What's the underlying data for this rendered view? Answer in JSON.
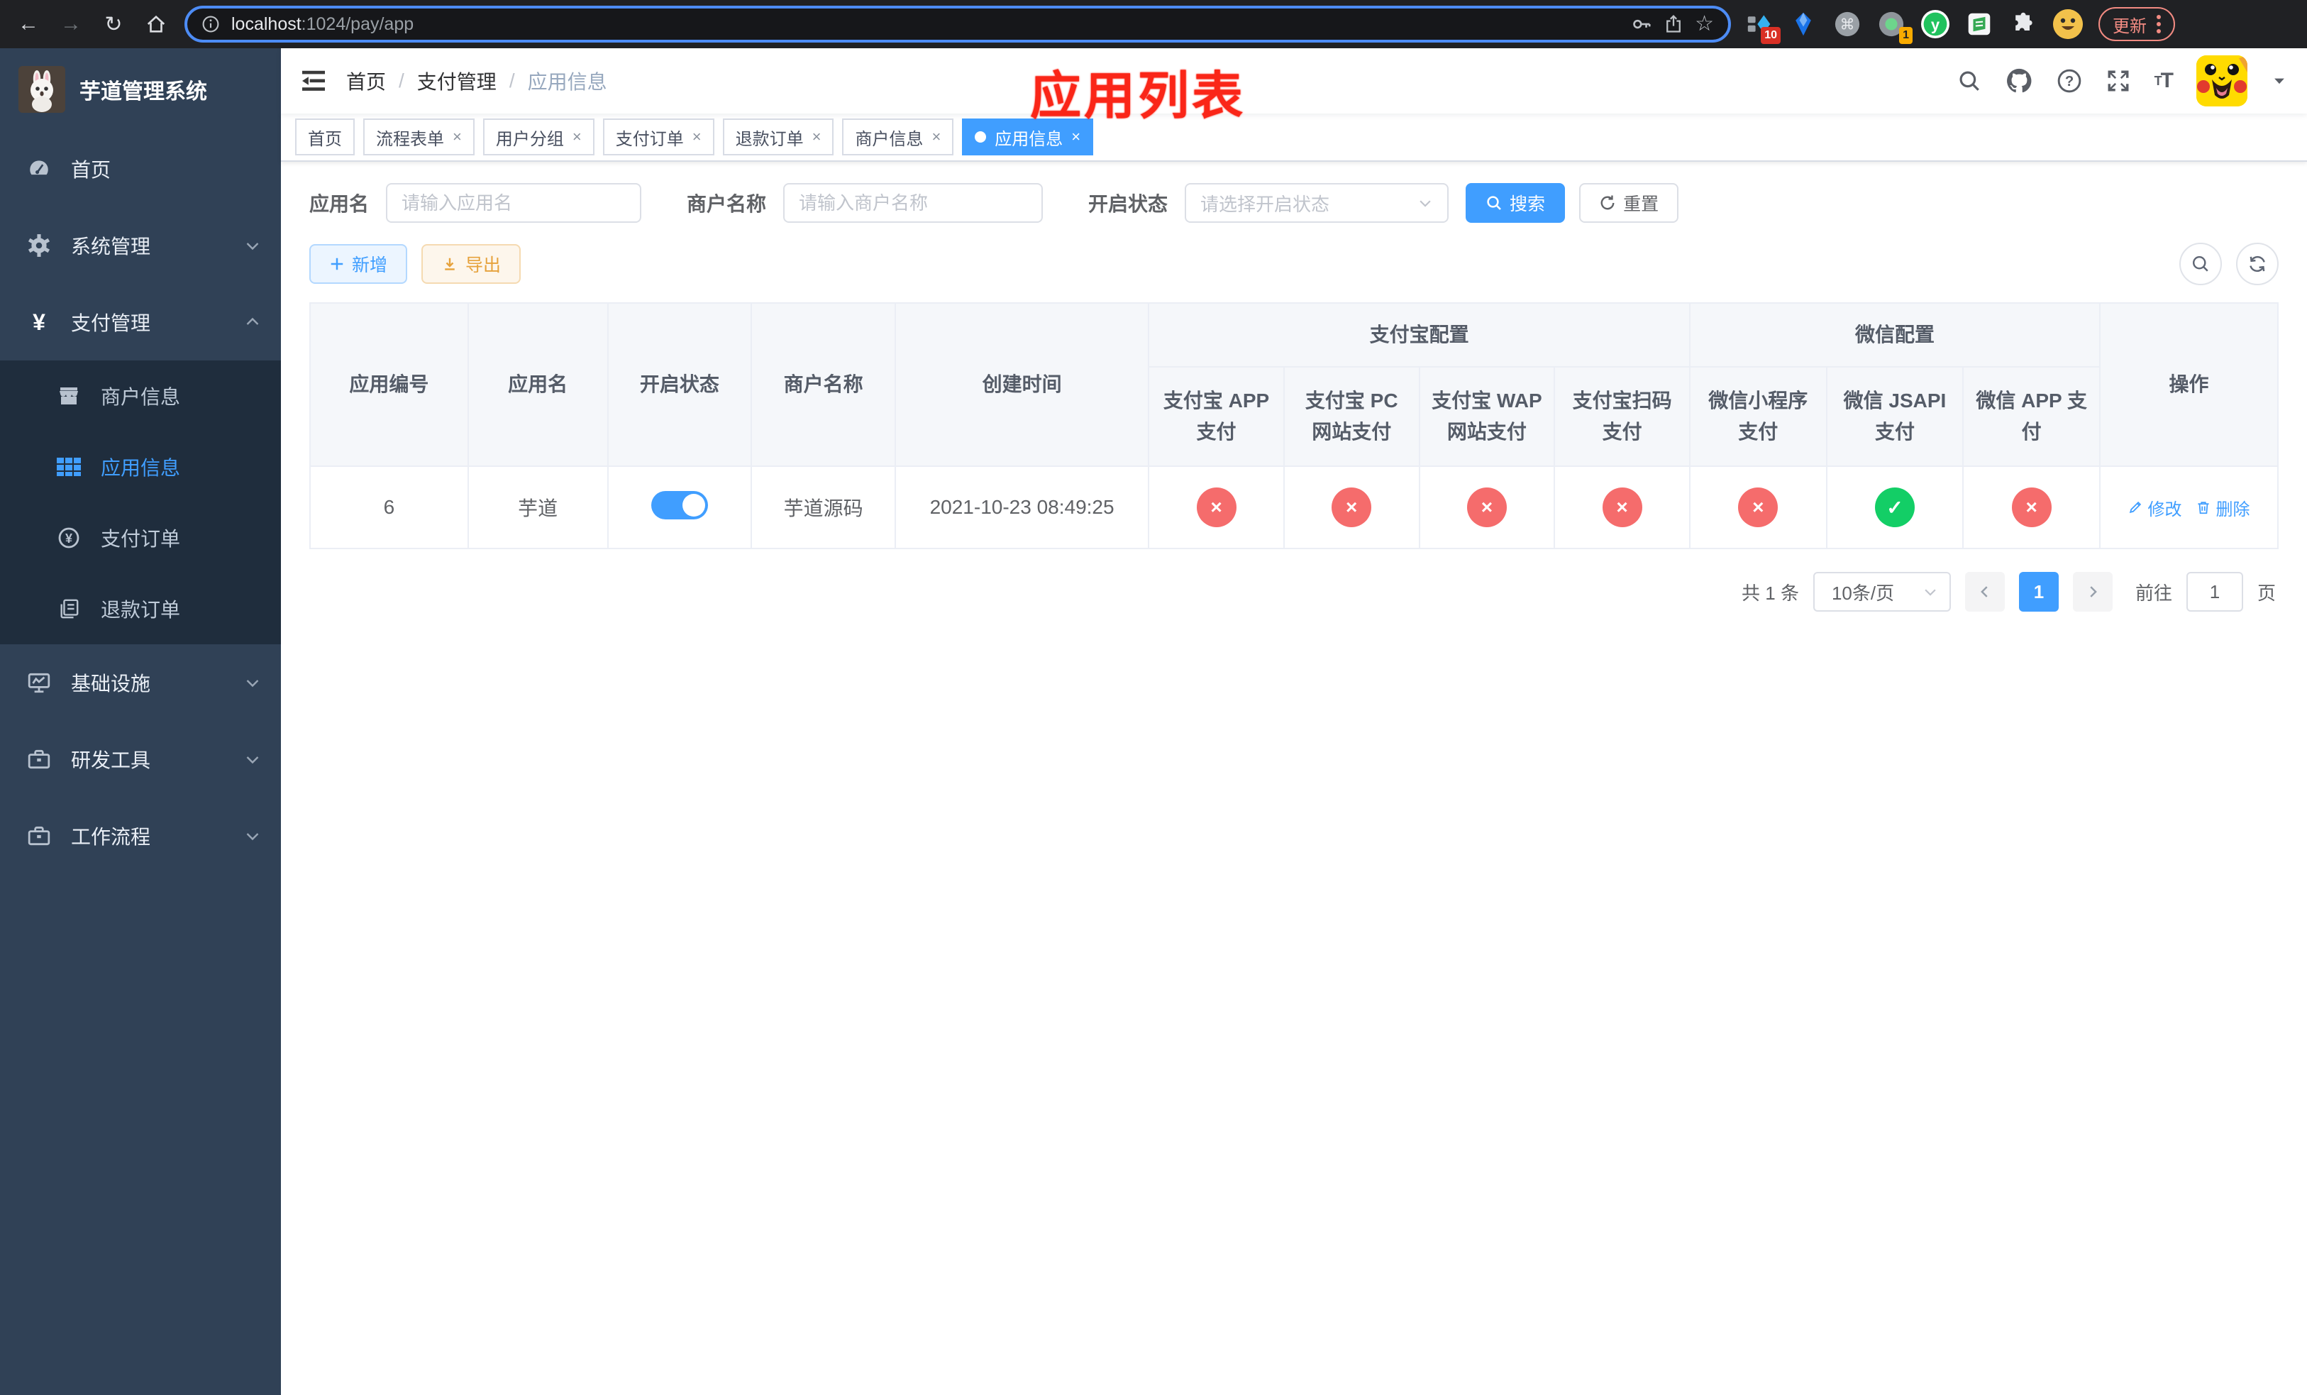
{
  "browser": {
    "url_host": "localhost",
    "url_rest": ":1024/pay/app",
    "update_label": "更新",
    "ext_badge_1": "10",
    "ext_badge_2": "1"
  },
  "glyphs": {
    "back": "←",
    "forward": "→",
    "reload": "↻",
    "star": "☆",
    "close": "×",
    "check": "✓",
    "command": "⌘",
    "y_logo": "y"
  },
  "sidebar": {
    "title": "芋道管理系统",
    "menu": [
      {
        "label": "首页"
      },
      {
        "label": "系统管理"
      },
      {
        "label": "支付管理",
        "children": [
          {
            "label": "商户信息"
          },
          {
            "label": "应用信息",
            "active": true
          },
          {
            "label": "支付订单"
          },
          {
            "label": "退款订单"
          }
        ]
      },
      {
        "label": "基础设施"
      },
      {
        "label": "研发工具"
      },
      {
        "label": "工作流程"
      }
    ]
  },
  "navbar": {
    "breadcrumb": [
      {
        "label": "首页"
      },
      {
        "label": "支付管理"
      },
      {
        "label": "应用信息"
      }
    ],
    "overlay_title": "应用列表"
  },
  "tabs": [
    {
      "label": "首页",
      "closable": false
    },
    {
      "label": "流程表单",
      "closable": true
    },
    {
      "label": "用户分组",
      "closable": true
    },
    {
      "label": "支付订单",
      "closable": true
    },
    {
      "label": "退款订单",
      "closable": true
    },
    {
      "label": "商户信息",
      "closable": true
    },
    {
      "label": "应用信息",
      "closable": true,
      "active": true
    }
  ],
  "filters": {
    "app_name_label": "应用名",
    "app_name_placeholder": "请输入应用名",
    "merchant_label": "商户名称",
    "merchant_placeholder": "请输入商户名称",
    "status_label": "开启状态",
    "status_placeholder": "请选择开启状态",
    "search_label": "搜索",
    "reset_label": "重置"
  },
  "toolbar": {
    "add_label": "新增",
    "export_label": "导出"
  },
  "table": {
    "header": {
      "app_id": "应用编号",
      "app_name": "应用名",
      "status": "开启状态",
      "merchant": "商户名称",
      "create_time": "创建时间",
      "alipay_group": "支付宝配置",
      "wechat_group": "微信配置",
      "actions": "操作",
      "alipay_app": "支付宝 APP 支付",
      "alipay_pc": "支付宝 PC 网站支付",
      "alipay_wap": "支付宝 WAP 网站支付",
      "alipay_qr": "支付宝扫码支付",
      "wechat_lite": "微信小程序支付",
      "wechat_jsapi": "微信 JSAPI 支付",
      "wechat_app": "微信 APP 支付"
    },
    "row": {
      "app_id": "6",
      "app_name": "芋道",
      "enabled": true,
      "merchant": "芋道源码",
      "create_time": "2021-10-23 08:49:25",
      "channels": [
        {
          "name": "alipay_app",
          "configured": false,
          "glyph": "×"
        },
        {
          "name": "alipay_pc",
          "configured": false,
          "glyph": "×"
        },
        {
          "name": "alipay_wap",
          "configured": false,
          "glyph": "×"
        },
        {
          "name": "alipay_qr",
          "configured": false,
          "glyph": "×"
        },
        {
          "name": "wechat_lite",
          "configured": false,
          "glyph": "×"
        },
        {
          "name": "wechat_jsapi",
          "configured": true,
          "glyph": "✓"
        },
        {
          "name": "wechat_app",
          "configured": false,
          "glyph": "×"
        }
      ],
      "edit_label": "修改",
      "delete_label": "删除"
    }
  },
  "pagination": {
    "total": "共 1 条",
    "page_size": "10条/页",
    "page": "1",
    "goto_label": "前往",
    "goto_value": "1",
    "goto_unit": "页"
  }
}
